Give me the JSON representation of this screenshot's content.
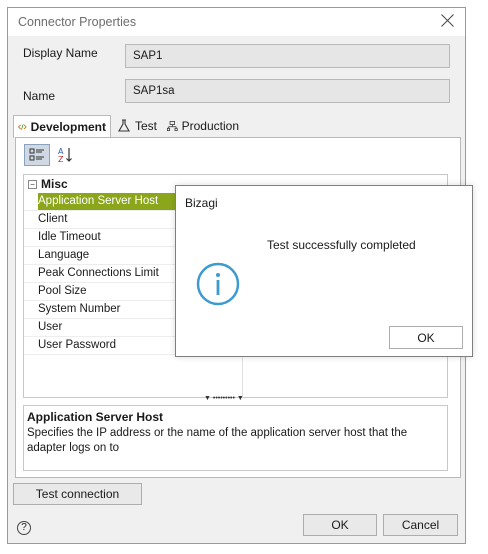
{
  "window": {
    "title": "Connector Properties"
  },
  "fields": {
    "display_name_label": "Display Name",
    "display_name_value": "SAP1",
    "name_label": "Name",
    "name_value": "SAP1sa"
  },
  "tabs": [
    {
      "label": "Development",
      "icon": "code-icon",
      "active": true
    },
    {
      "label": "Test",
      "icon": "flask-icon",
      "active": false
    },
    {
      "label": "Production",
      "icon": "server-icon",
      "active": false
    }
  ],
  "grid": {
    "category": "Misc",
    "properties": [
      "Application Server Host",
      "Client",
      "Idle Timeout",
      "Language",
      "Peak Connections Limit",
      "Pool Size",
      "System Number",
      "User",
      "User Password"
    ],
    "selected_index": 0
  },
  "description": {
    "title": "Application Server Host",
    "text": "Specifies the IP address or the name of the application server host that the adapter logs on to"
  },
  "buttons": {
    "test_connection": "Test connection",
    "ok": "OK",
    "cancel": "Cancel"
  },
  "modal": {
    "title": "Bizagi",
    "message": "Test successfully completed",
    "ok": "OK"
  },
  "colors": {
    "selection": "#8ba61b",
    "info": "#3d9bd0"
  }
}
